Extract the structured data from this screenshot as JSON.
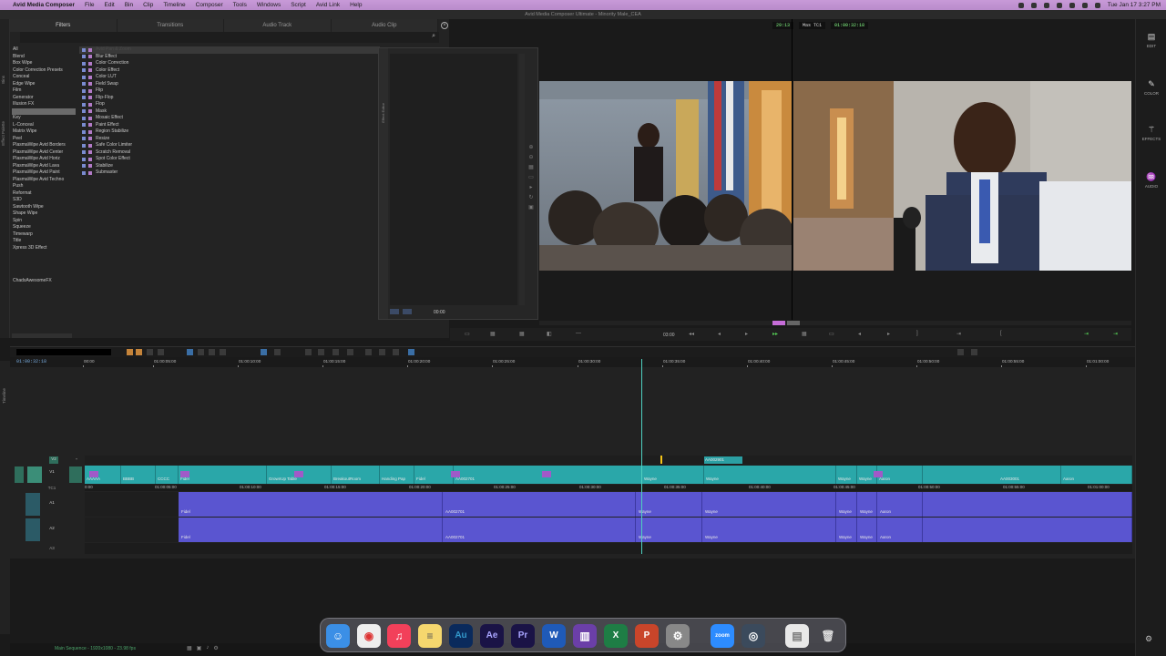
{
  "menubar": {
    "app_name": "Avid Media Composer",
    "items": [
      "File",
      "Edit",
      "Bin",
      "Clip",
      "Timeline",
      "Composer",
      "Tools",
      "Windows",
      "Script",
      "Avid Link",
      "Help"
    ],
    "datetime": "Tue Jan 17  3:27 PM"
  },
  "window": {
    "title": "Avid Media Composer Ultimate - Minority Male_CEA",
    "left_tc": "29:13",
    "tc_mode": "Mas  TC1",
    "tc_value": "01:00:32:18"
  },
  "right_bar": {
    "items": [
      {
        "label": "EDIT",
        "icon": "grid-icon"
      },
      {
        "label": "COLOR",
        "icon": "pen-icon"
      },
      {
        "label": "EFFECTS",
        "icon": "wand-icon"
      },
      {
        "label": "AUDIO",
        "icon": "waveform-icon"
      }
    ]
  },
  "left_strip": {
    "labels": [
      "Bins",
      "Effect Palette"
    ],
    "timeline_label": "Timeline"
  },
  "effect_palette": {
    "tabs": [
      "Filters",
      "Transitions",
      "Audio Track",
      "Audio Clip"
    ],
    "categories": [
      "All",
      "Blend",
      "Box Wipe",
      "Color Correction Presets",
      "Conceal",
      "Edge Wipe",
      "Film",
      "Generator",
      "Illusion FX",
      "Image",
      "Key",
      "L-Conceal",
      "Matrix Wipe",
      "Peel",
      "PlasmaWipe Avid Borders",
      "PlasmaWipe Avid Center",
      "PlasmaWipe Avid Horiz",
      "PlasmaWipe Avid Lava",
      "PlasmaWipe Avid Paint",
      "PlasmaWipe Avid Techno",
      "Push",
      "Reformat",
      "S3D",
      "Sawtooth Wipe",
      "Shape Wipe",
      "Spin",
      "Squeeze",
      "Timewarp",
      "Title",
      "Xpress 3D Effect"
    ],
    "selected_category": "Image",
    "extra_category": "ChadsAwesomeFX",
    "effects": [
      "Avid Pan & Zoom",
      "Blur Effect",
      "Color Correction",
      "Color Effect",
      "Color LUT",
      "Field Swap",
      "Flip",
      "Flip-Flop",
      "Flop",
      "Mask",
      "Mosaic Effect",
      "Paint Effect",
      "Region Stabilize",
      "Resize",
      "Safe Color Limiter",
      "Scratch Removal",
      "Spot Color Effect",
      "Stabilize",
      "Submaster"
    ]
  },
  "effect_editor": {
    "side_label": "Effect Editor",
    "time": "00:00"
  },
  "viewer": {
    "time_display": "03:00"
  },
  "timeline": {
    "current_tc": "01:00:32:18",
    "ruler": [
      "00:00",
      "01:00:05:00",
      "01:00:10:00",
      "01:00:15:00",
      "01:00:20:00",
      "01:00:25:00",
      "01:00:30:00",
      "01:00:35:00",
      "01:00:40:00",
      "01:00:45:00",
      "01:00:50:00",
      "01:00:55:00",
      "01:01:00:00"
    ],
    "tracks": {
      "v2": "V2",
      "v1": "V1",
      "tc1": "TC1",
      "a1": "A1",
      "a2": "A2",
      "a3": "A3"
    },
    "v2_clip": "AA002901",
    "v1_clips": [
      "AAAAA",
      "BBBB",
      "CCCC",
      "Fidel",
      "GrownUp Table",
      "BreakoutRoom",
      "Handing Pap",
      "Fidel",
      "AA002701",
      "Wayne",
      "Wayne",
      "Wayne",
      "Wayne",
      "Aaron",
      "AA003001",
      "Aaron"
    ],
    "tc_marks": [
      "0:00",
      "01:00:05:00",
      "01:00:10:00",
      "01:00:15:00",
      "01:00:20:00",
      "01:00:25:00",
      "01:00:30:00",
      "01:00:35:00",
      "01:00:40:00",
      "01:00:45:00",
      "01:00:50:00",
      "01:00:55:00",
      "01:01:00:00"
    ],
    "audio_clips": [
      "Fidel",
      "AA002701",
      "Wayne",
      "Wayne",
      "Wayne",
      "Wayne",
      "Aaron"
    ]
  },
  "status": {
    "sequence": "Main Sequence - 1920x1080 - 23.98 fps"
  },
  "dock": {
    "apps": [
      "Finder",
      "Chrome",
      "Music",
      "Notes",
      "Au",
      "Ae",
      "Pr",
      "W",
      "Media Composer",
      "X",
      "P",
      "System Settings",
      "zoom",
      "QuickTime",
      "Preview",
      "Trash"
    ]
  }
}
